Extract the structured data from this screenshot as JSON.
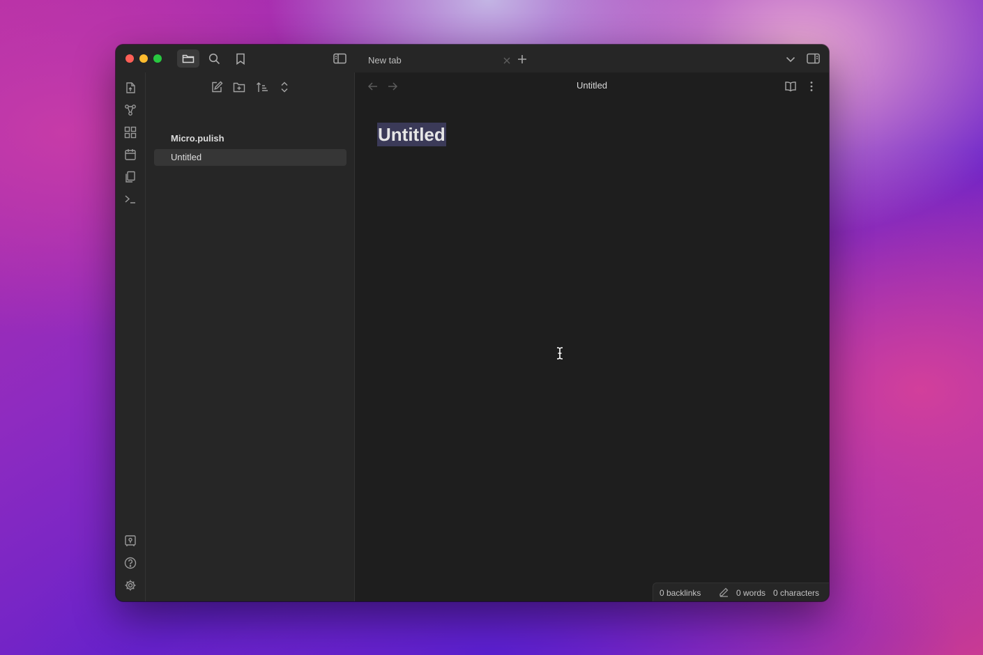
{
  "window": {
    "traffic_lights": {
      "close": "#ff5f57",
      "minimize": "#febc2e",
      "maximize": "#28c840"
    },
    "toolbar_icons": [
      "folder-icon",
      "search-icon",
      "bookmark-icon",
      "sidebar-toggle-icon"
    ],
    "tabs": [
      {
        "label": "New tab"
      }
    ],
    "right_icons": [
      "chevron-down-icon",
      "right-sidebar-toggle-icon"
    ]
  },
  "ribbon": {
    "top_icons": [
      "open-quick-switcher-icon",
      "graph-view-icon",
      "canvas-icon",
      "daily-note-calendar-icon",
      "templates-icon",
      "command-palette-terminal-icon"
    ],
    "bottom_icons": [
      "vault-switcher-icon",
      "help-icon",
      "settings-gear-icon"
    ]
  },
  "sidebar": {
    "actions": [
      "new-note-icon",
      "new-folder-icon",
      "sort-icon",
      "collapse-expand-icon"
    ],
    "vault_name": "Micro.pulish",
    "files": [
      {
        "label": "Untitled",
        "selected": true
      }
    ]
  },
  "main": {
    "view_title": "Untitled",
    "note_title": "Untitled"
  },
  "status_bar": {
    "backlinks": "0 backlinks",
    "words": "0 words",
    "characters": "0 characters"
  },
  "colors": {
    "window_bg": "#1e1e1e",
    "panel_bg": "#262626",
    "selection": "#3b3a58"
  }
}
